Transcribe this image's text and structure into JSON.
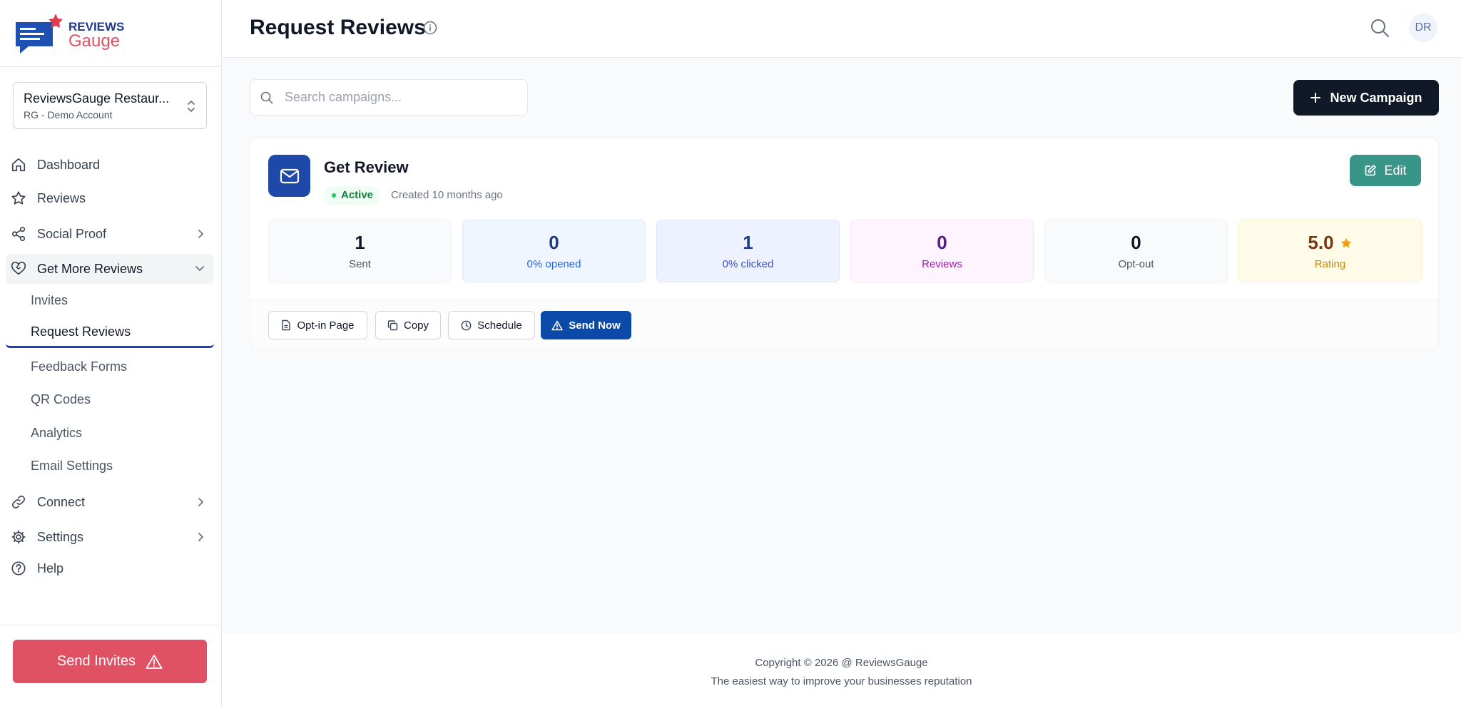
{
  "brand": {
    "top": "REVIEWS",
    "bottom": "Gauge"
  },
  "account": {
    "name": "ReviewsGauge Restaur...",
    "sub": "RG - Demo Account"
  },
  "nav": {
    "dashboard": "Dashboard",
    "reviews": "Reviews",
    "social_proof": "Social Proof",
    "get_more_reviews": "Get More Reviews",
    "sub": {
      "invites": "Invites",
      "request_reviews": "Request Reviews",
      "feedback_forms": "Feedback Forms",
      "qr_codes": "QR Codes",
      "analytics": "Analytics",
      "email_settings": "Email Settings"
    },
    "connect": "Connect",
    "settings": "Settings",
    "help": "Help"
  },
  "send_invites": "Send Invites",
  "header": {
    "title": "Request Reviews",
    "avatar": "DR"
  },
  "search": {
    "placeholder": "Search campaigns...",
    "value": ""
  },
  "new_campaign": "New Campaign",
  "campaign": {
    "name": "Get Review",
    "status": "Active",
    "created": "Created 10 months ago",
    "edit": "Edit",
    "stats": {
      "sent": {
        "value": "1",
        "label": "Sent"
      },
      "opened": {
        "value": "0",
        "label": "0% opened"
      },
      "clicked": {
        "value": "1",
        "label": "0% clicked"
      },
      "reviews": {
        "value": "0",
        "label": "Reviews"
      },
      "optout": {
        "value": "0",
        "label": "Opt-out"
      },
      "rating": {
        "value": "5.0",
        "label": "Rating"
      }
    },
    "actions": {
      "optin": "Opt-in Page",
      "copy": "Copy",
      "schedule": "Schedule",
      "send_now": "Send Now"
    }
  },
  "footer": {
    "line1": "Copyright © 2026 @ ReviewsGauge",
    "line2": "The easiest way to improve your businesses reputation"
  },
  "colors": {
    "accent": "#1e49a8",
    "send_invites": "#e05163",
    "edit": "#3a9589",
    "star": "#f59e0b"
  }
}
